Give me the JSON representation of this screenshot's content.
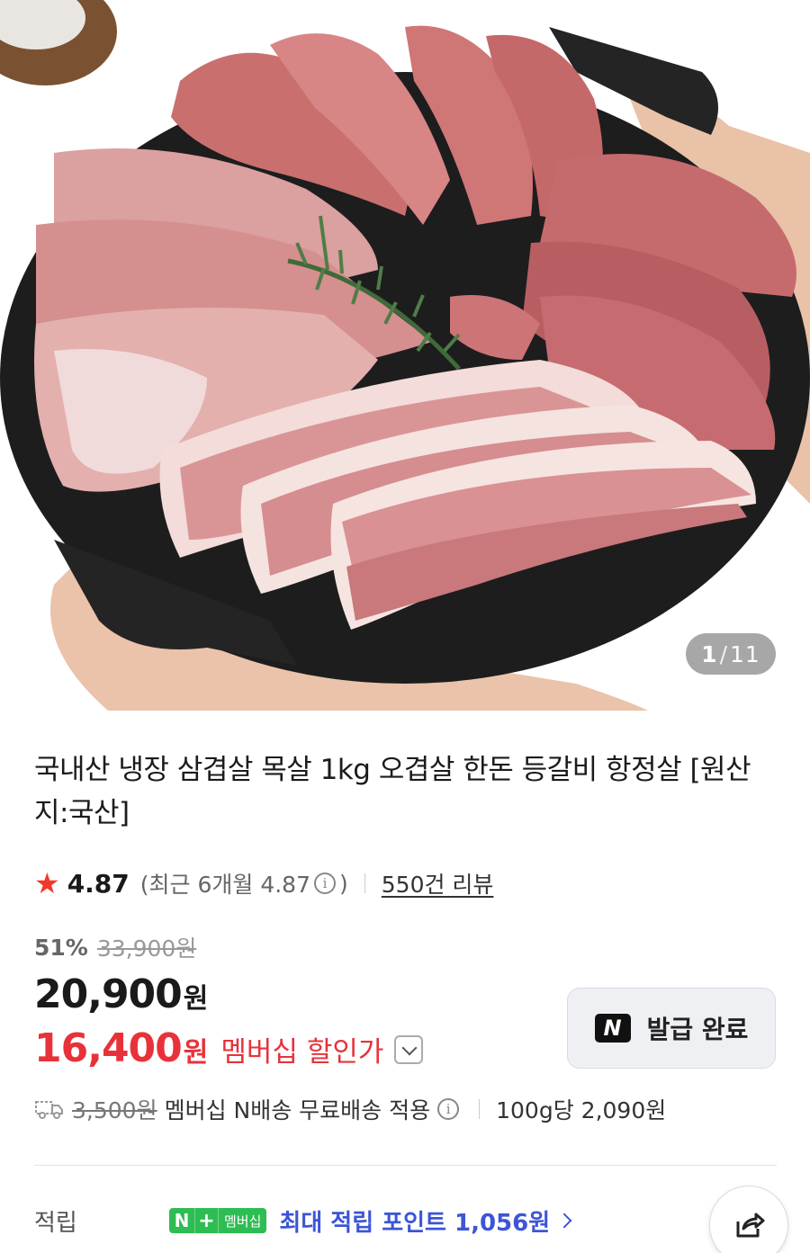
{
  "gallery": {
    "current": "1",
    "separator": "/",
    "total": "11"
  },
  "product": {
    "title": "국내산 냉장 삼겹살 목살 1kg 오겹살 한돈 등갈비 항정살 [원산지:국산]"
  },
  "rating": {
    "score": "4.87",
    "recent": "(최근 6개월 4.87",
    "recent_close": ")",
    "reviews": "550건 리뷰"
  },
  "pricing": {
    "discount_pct": "51%",
    "original_price": "33,900원",
    "price": "20,900",
    "price_unit": "원",
    "member_price": "16,400",
    "member_unit": "원",
    "member_label": "멤버십 할인가"
  },
  "coupon": {
    "label": "발급 완료",
    "logo": "N"
  },
  "shipping": {
    "old_fee": "3,500원",
    "text": "멤버십 N배송 무료배송 적용",
    "unit_price": "100g당 2,090원"
  },
  "points": {
    "label": "적립",
    "badge_n": "N",
    "badge_plus": "+",
    "badge_member": "멤버십",
    "text": "최대 적립 포인트 1,056원"
  },
  "icons": {
    "rating": "star-icon",
    "info": "info-icon",
    "coupon": "naver-n-icon",
    "shipping": "truck-icon",
    "share": "share-icon",
    "dropdown": "chevron-down-icon"
  },
  "colors": {
    "accent_red": "#e8323a",
    "star": "#f0392b",
    "points_blue": "#3d55d6",
    "membership_green": "#2ebd52"
  }
}
